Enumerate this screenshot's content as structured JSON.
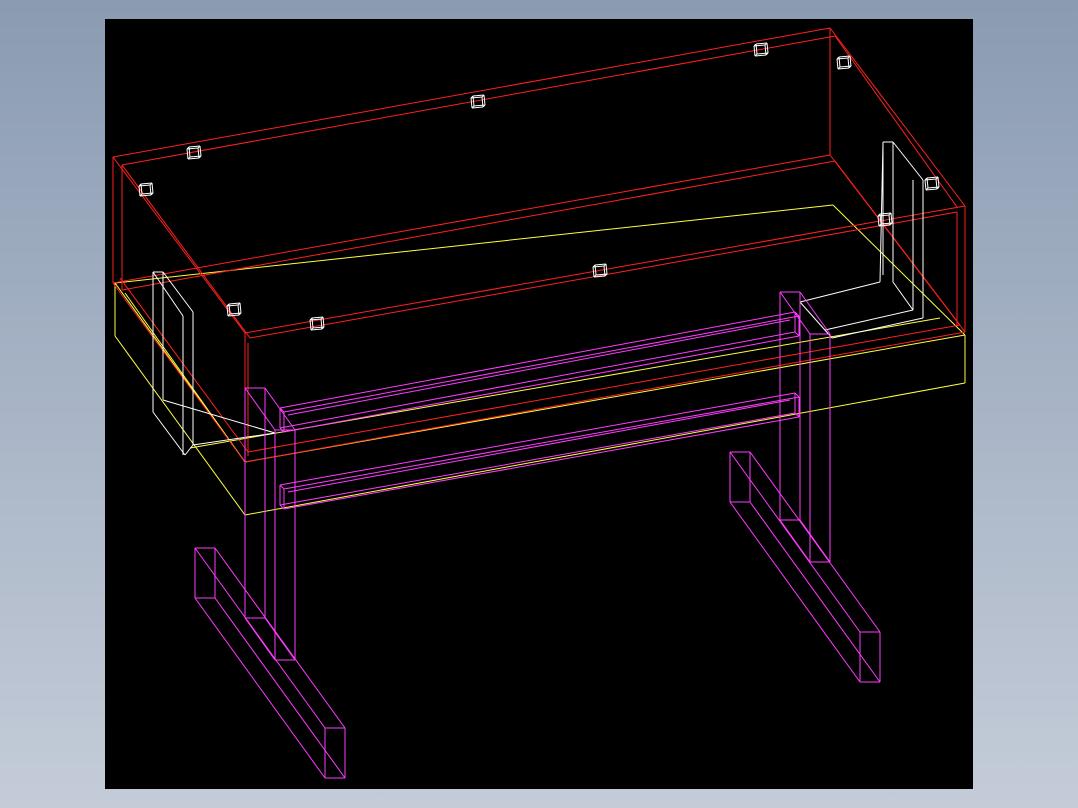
{
  "colors": {
    "background": "#000000",
    "tabletop": "#ff2020",
    "apron": "#ffff40",
    "brackets": "#ffffff",
    "legs": "#ff3cff",
    "connectors": "#ffffff"
  },
  "parts": {
    "tabletop": {
      "name": "tabletop"
    },
    "apron": {
      "name": "apron-frame"
    },
    "brackets": {
      "name": "corner-brackets"
    },
    "legs": {
      "name": "leg-frames"
    },
    "connectors": {
      "name": "connector-blocks"
    }
  }
}
